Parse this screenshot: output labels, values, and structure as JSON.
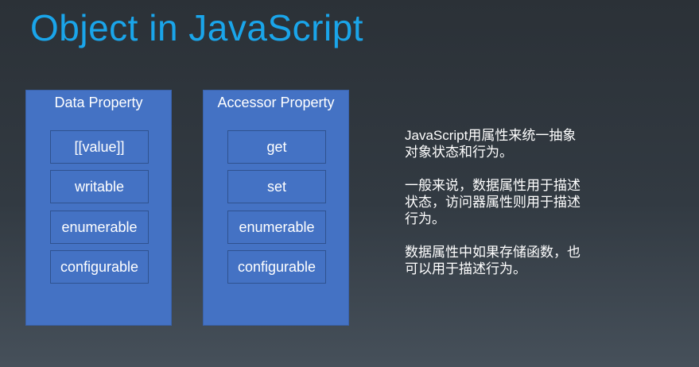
{
  "title": "Object in JavaScript",
  "data_property": {
    "heading": "Data Property",
    "attributes": [
      "[[value]]",
      "writable",
      "enumerable",
      "configurable"
    ]
  },
  "accessor_property": {
    "heading": "Accessor Property",
    "attributes": [
      "get",
      "set",
      "enumerable",
      "configurable"
    ]
  },
  "notes": [
    [
      "JavaScript用属性来统一抽象",
      "对象状态和行为。"
    ],
    [
      "一般来说，数据属性用于描述",
      "状态，访问器属性则用于描述",
      "行为。"
    ],
    [
      "数据属性中如果存储函数，也",
      "可以用于描述行为。"
    ]
  ],
  "colors": {
    "title": "#1aa5ea",
    "panel": "#4472c4",
    "attribute_border": "#2f528f",
    "text": "#ffffff"
  }
}
